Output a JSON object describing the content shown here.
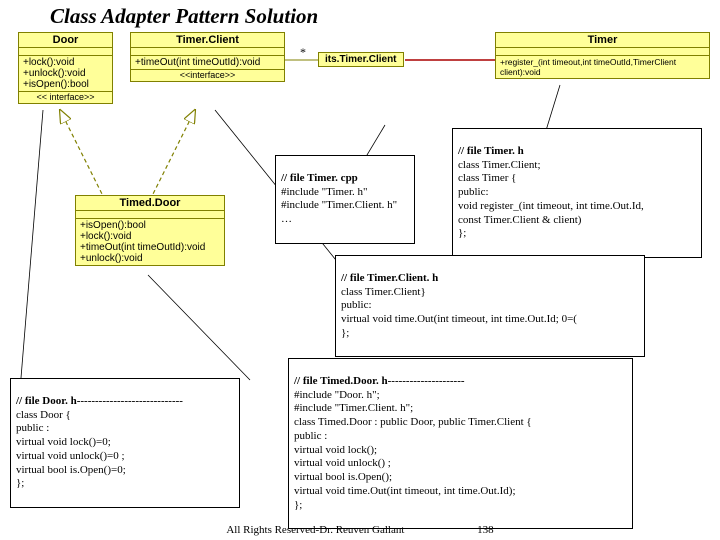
{
  "title": "Class Adapter Pattern Solution",
  "uml": {
    "door": {
      "name": "Door",
      "ops": "+lock():void\n+unlock():void\n+isOpen():bool",
      "stereo": "<< interface>>"
    },
    "timerClient": {
      "name": "Timer.Client",
      "ops": "+timeOut(int timeOutId):void",
      "stereo": "<<interface>>"
    },
    "timer": {
      "name": "Timer",
      "ops": "+register_(int timeout,int timeOutId,TimerClient client):void"
    },
    "itsLabel": "its.Timer.Client",
    "timedDoor": {
      "name": "Timed.Door",
      "ops": "+isOpen():bool\n+lock():void\n+timeOut(int timeOutId):void\n+unlock():void"
    }
  },
  "star": "*",
  "code": {
    "timerCpp": {
      "hdr": "// file Timer. cpp",
      "body": "#include \"Timer. h\"\n#include \"Timer.Client. h\"\n…"
    },
    "timerH": {
      "hdr": "// file Timer. h",
      "body": "class Timer.Client;\nclass Timer {\n public:\n   void register_(int timeout, int time.Out.Id,\n        const Timer.Client & client)\n};"
    },
    "timerClientH": {
      "hdr": " // file Timer.Client. h",
      "body": "class Timer.Client}\npublic:\nvirtual void time.Out(int timeout, int time.Out.Id; 0=(\n};"
    },
    "doorH": {
      "hdr": "// file Door. h-----------------------------",
      "body": "class Door {\npublic  :\n    virtual void lock()=0;\n    virtual void unlock()=0 ;\n    virtual bool is.Open()=0;\n};"
    },
    "timedDoorH": {
      "hdr": "// file Timed.Door. h---------------------",
      "body": "#include \"Door. h\";\n#include \"Timer.Client. h\";\nclass Timed.Door  : public Door, public Timer.Client {\npublic  :\n    virtual void lock();\n    virtual void unlock() ;\n    virtual bool is.Open();\n    virtual void time.Out(int timeout, int time.Out.Id);\n};"
    }
  },
  "footer": {
    "copyright": "All Rights Reserved-Dr. Reuven Gallant",
    "page": "138"
  }
}
